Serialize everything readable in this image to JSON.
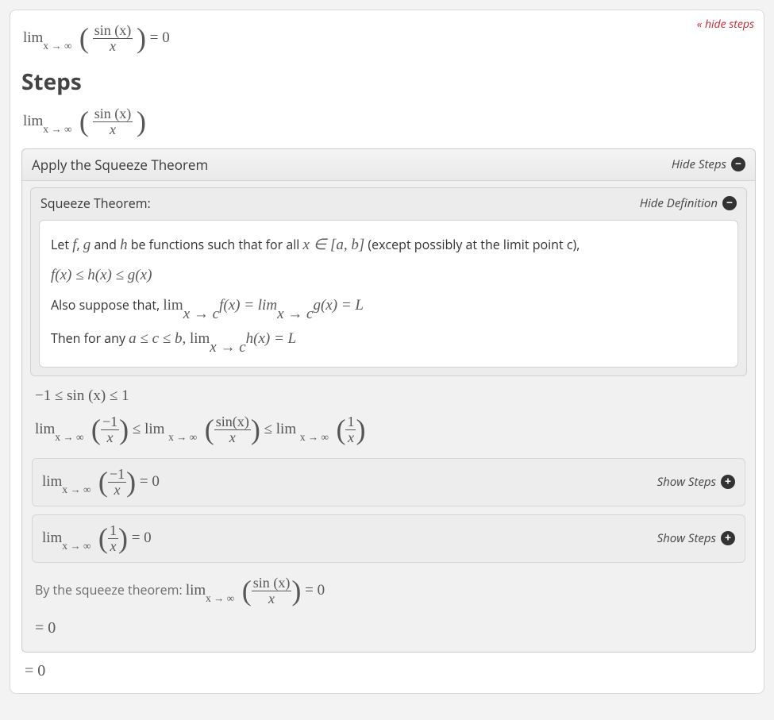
{
  "top": {
    "hide_link": "« hide steps"
  },
  "header_eq": {
    "prefix": "lim",
    "sub": "x → ∞",
    "frac_num": "sin (x)",
    "frac_den": "x",
    "rhs": " = 0"
  },
  "steps_heading": "Steps",
  "restate_eq": {
    "prefix": "lim",
    "sub": "x → ∞",
    "frac_num": "sin (x)",
    "frac_den": "x"
  },
  "panel1": {
    "title": "Apply the Squeeze Theorem",
    "ctrl": "Hide Steps",
    "def_title": "Squeeze Theorem:",
    "def_ctrl": "Hide Definition",
    "def_line1_a": "Let ",
    "def_line1_b": "f",
    "def_line1_c": ", ",
    "def_line1_d": "g",
    "def_line1_e": " and ",
    "def_line1_f": "h",
    "def_line1_g": " be functions such that for all ",
    "def_line1_h": "x ∈ [a, b]",
    "def_line1_i": " (except possibly at the limit point c),",
    "def_line2": "f(x) ≤ h(x) ≤ g(x)",
    "def_line3_a": "Also suppose that, ",
    "def_line3_b": "lim",
    "def_line3_sub1": "x → c",
    "def_line3_c": "f(x) = lim",
    "def_line3_sub2": "x → c",
    "def_line3_d": "g(x) = L",
    "def_line4_a": "Then for any ",
    "def_line4_b": "a ≤ c ≤ b",
    "def_line4_c": ", lim",
    "def_line4_sub": "x → c",
    "def_line4_d": "h(x) = L"
  },
  "work": {
    "bounds": "−1 ≤ sin (x) ≤  1",
    "chain": {
      "l1": "lim",
      "l1sub": "x → ∞",
      "l1num": "−1",
      "l1den": "x",
      "leq1": " ≤ lim ",
      "l2sub": "x → ∞",
      "l2num": "sin(x)",
      "l2den": "x",
      "leq2": " ≤ lim ",
      "l3sub": "x → ∞",
      "l3num": "1",
      "l3den": "x"
    }
  },
  "sub1": {
    "prefix": "lim",
    "sub": "x → ∞",
    "num": "−1",
    "den": "x",
    "rhs": " = 0",
    "ctrl": "Show Steps"
  },
  "sub2": {
    "prefix": "lim",
    "sub": "x → ∞",
    "num": "1",
    "den": "x",
    "rhs": " = 0",
    "ctrl": "Show Steps"
  },
  "conclusion": {
    "text": "By the squeeze theorem: ",
    "prefix": "lim",
    "sub": "x → ∞",
    "num": "sin (x)",
    "den": "x",
    "rhs": " = 0"
  },
  "final_inner": "= 0",
  "final_outer": "= 0"
}
